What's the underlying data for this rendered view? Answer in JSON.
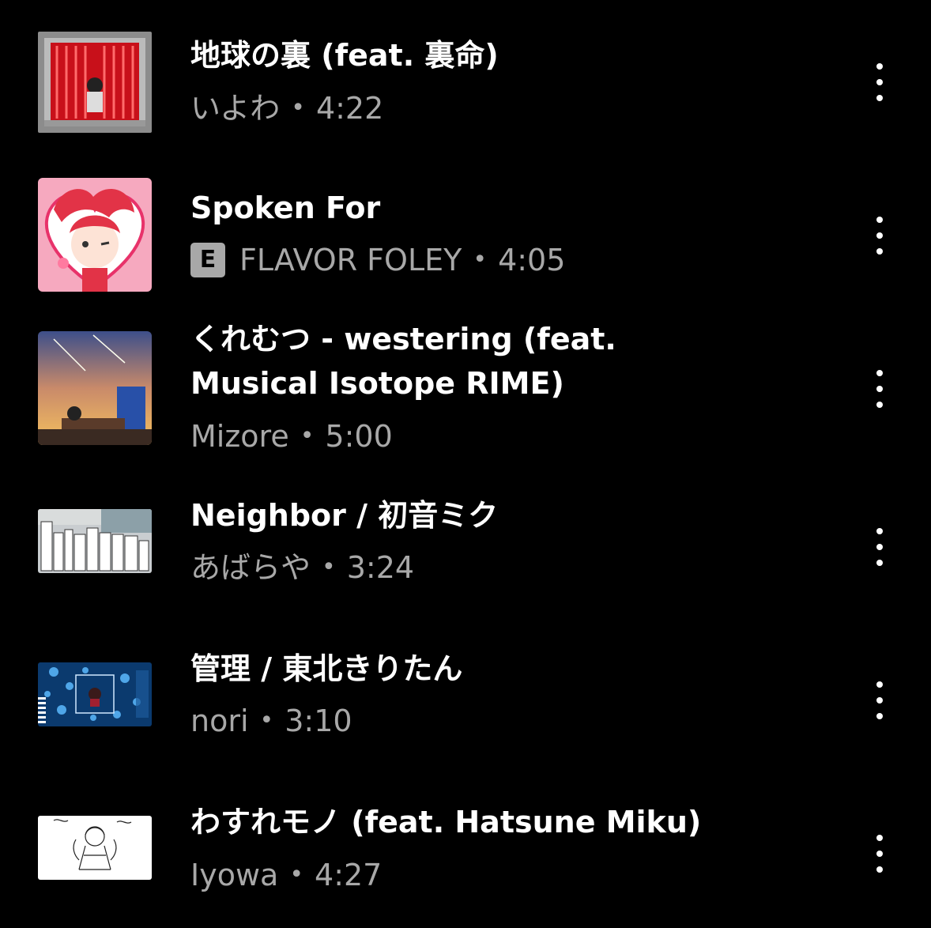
{
  "tracks": [
    {
      "title": "地球の裏 (feat. 裏命)",
      "artist": "いよわ",
      "separator": "•",
      "duration": "4:22",
      "explicit": false,
      "thumbnail": "red-pixel-cage-art"
    },
    {
      "title": "Spoken For",
      "artist": "FLAVOR FOLEY",
      "separator": "•",
      "duration": "4:05",
      "explicit": true,
      "explicit_label": "E",
      "thumbnail": "pink-heart-anime-art"
    },
    {
      "title": "くれむつ - westering (feat. Musical Isotope RIME)",
      "artist": "Mizore",
      "separator": "•",
      "duration": "5:00",
      "explicit": false,
      "thumbnail": "sunset-city-art"
    },
    {
      "title": "Neighbor / 初音ミク",
      "artist": "あばらや",
      "separator": "•",
      "duration": "3:24",
      "explicit": false,
      "thumbnail": "neighbor-text-art"
    },
    {
      "title": "管理 / 東北きりたん",
      "artist": "nori",
      "separator": "•",
      "duration": "3:10",
      "explicit": false,
      "thumbnail": "blue-space-art"
    },
    {
      "title": "わすれモノ (feat. Hatsune Miku)",
      "artist": "Iyowa",
      "separator": "•",
      "duration": "4:27",
      "explicit": false,
      "thumbnail": "white-sketch-art"
    }
  ],
  "icons": {
    "more": "more-vertical-icon",
    "explicit": "explicit-badge-icon"
  },
  "colors": {
    "background": "#000000",
    "title": "#ffffff",
    "subtitle": "#a8a8a8"
  }
}
